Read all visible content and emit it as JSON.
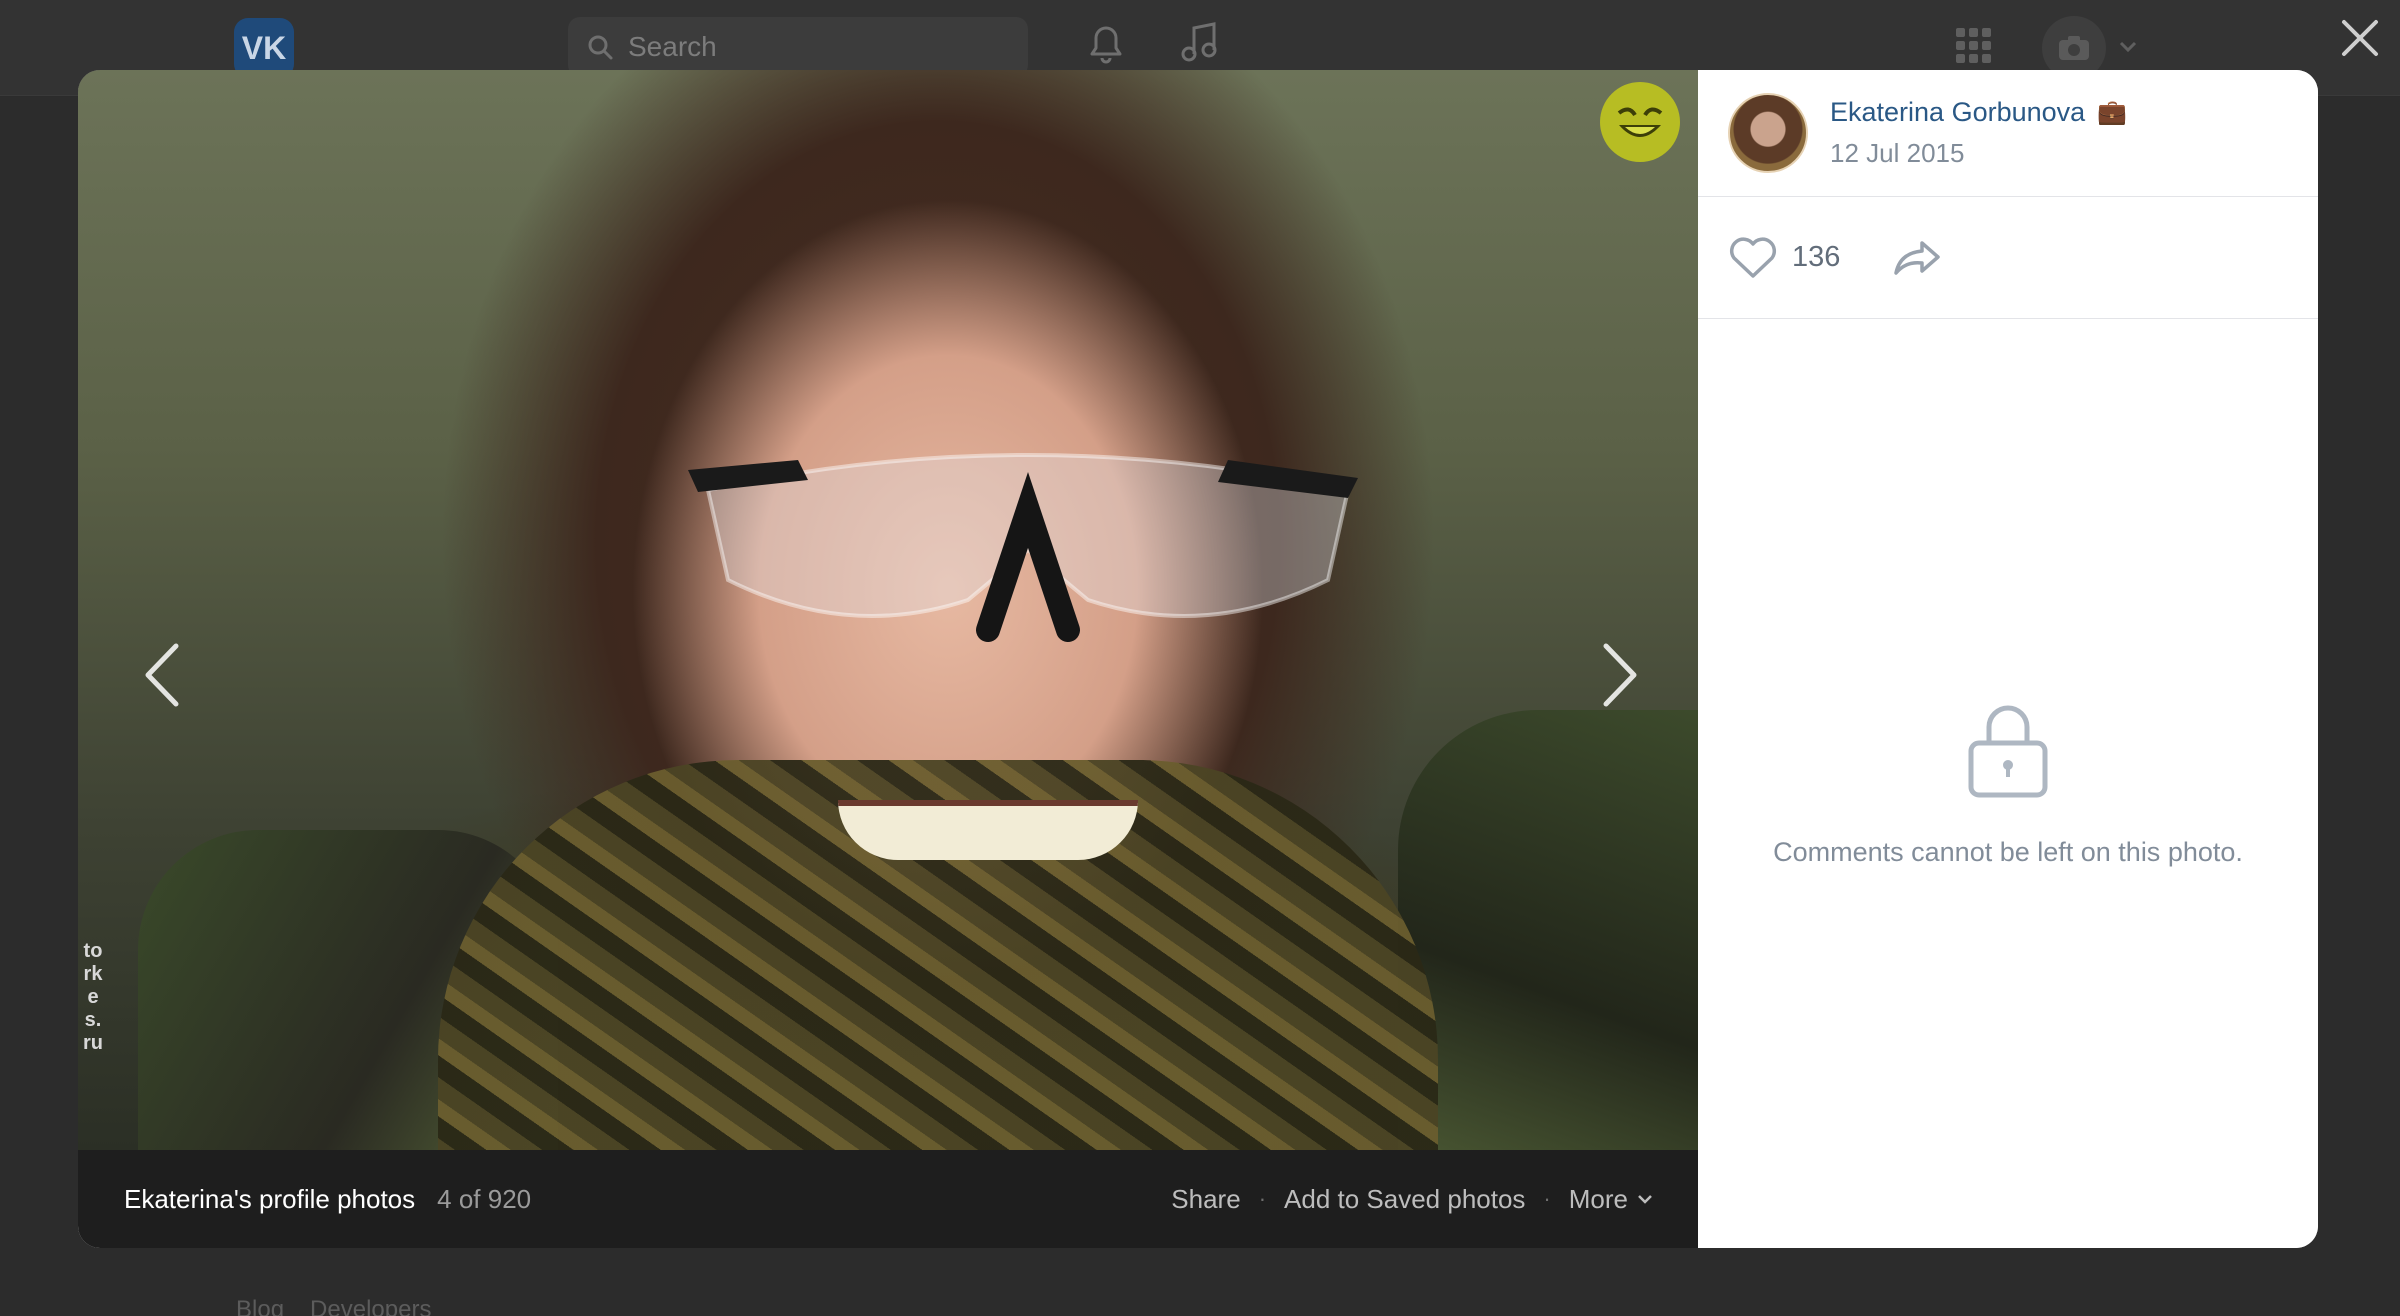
{
  "bg": {
    "logo": "VK",
    "search_placeholder": "Search",
    "footer_links": [
      "Blog",
      "Developers"
    ]
  },
  "viewer": {
    "album_title": "Ekaterina's profile photos",
    "counter": "4 of 920",
    "actions": {
      "share": "Share",
      "save": "Add to Saved photos",
      "more": "More"
    },
    "watermark": "torkes.ru"
  },
  "author": {
    "name": "Ekaterina Gorbunova",
    "badge": "💼",
    "date": "12 Jul 2015"
  },
  "likes": {
    "count": "136"
  },
  "comments": {
    "disabled_text": "Comments cannot be left on this photo."
  },
  "colors": {
    "link": "#2a5885",
    "muted": "#818c99",
    "badge": "#b7bd23"
  },
  "icons": [
    "search-icon",
    "bell-icon",
    "music-icon",
    "apps-grid-icon",
    "camera-icon",
    "close-icon",
    "chevron-left-icon",
    "chevron-right-icon",
    "heart-icon",
    "share-icon",
    "lock-icon",
    "chevron-down-icon",
    "smiley-badge-icon"
  ]
}
